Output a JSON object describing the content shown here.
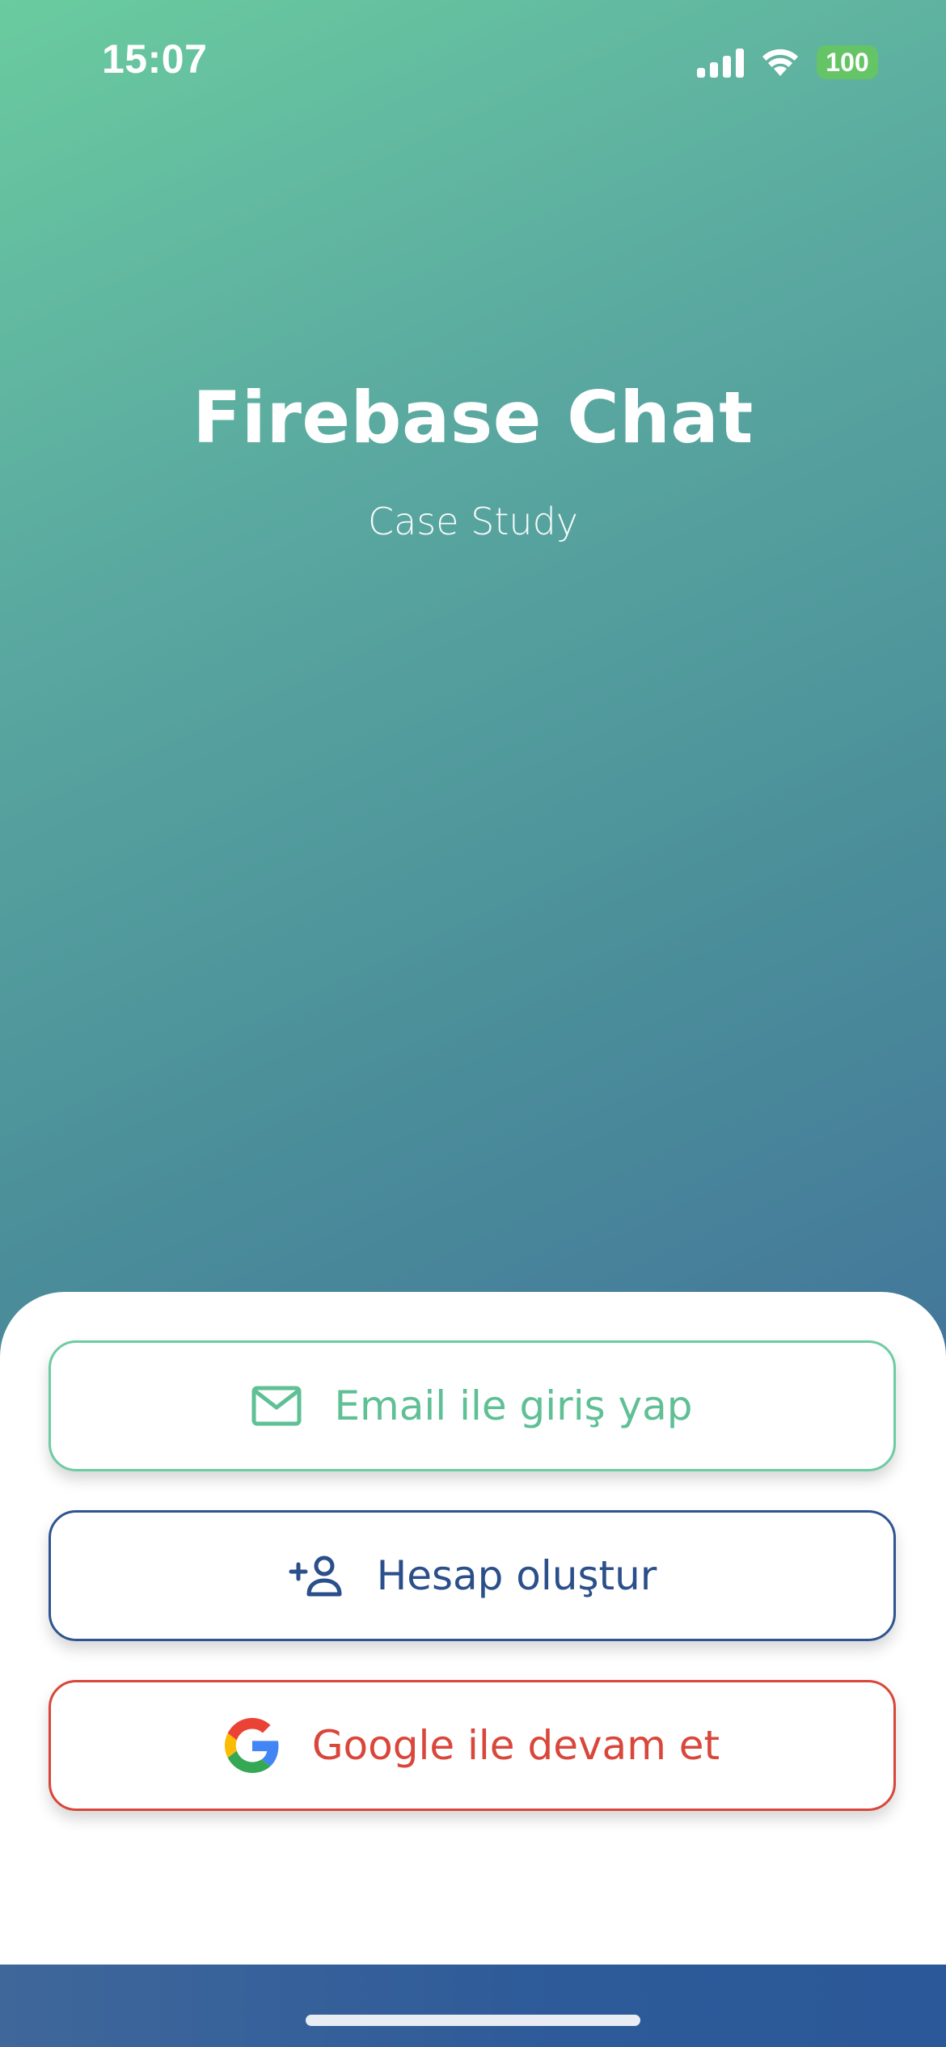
{
  "status_bar": {
    "time": "15:07",
    "battery": "100",
    "icons": [
      "signal-icon",
      "wifi-icon",
      "battery-icon"
    ]
  },
  "hero": {
    "title": "Firebase Chat",
    "subtitle": "Case Study"
  },
  "actions": {
    "email_login": {
      "label": "Email ile giriş yap",
      "icon": "mail-icon",
      "color": "#6dcca3"
    },
    "create_account": {
      "label": "Hesap oluştur",
      "icon": "add-person-icon",
      "color": "#2b4f8a"
    },
    "google": {
      "label": "Google ile devam et",
      "icon": "google-icon",
      "color": "#d9463a"
    }
  },
  "colors": {
    "gradient_top": "#6acb9f",
    "gradient_bottom": "#2d5694",
    "battery": "#65c466"
  }
}
